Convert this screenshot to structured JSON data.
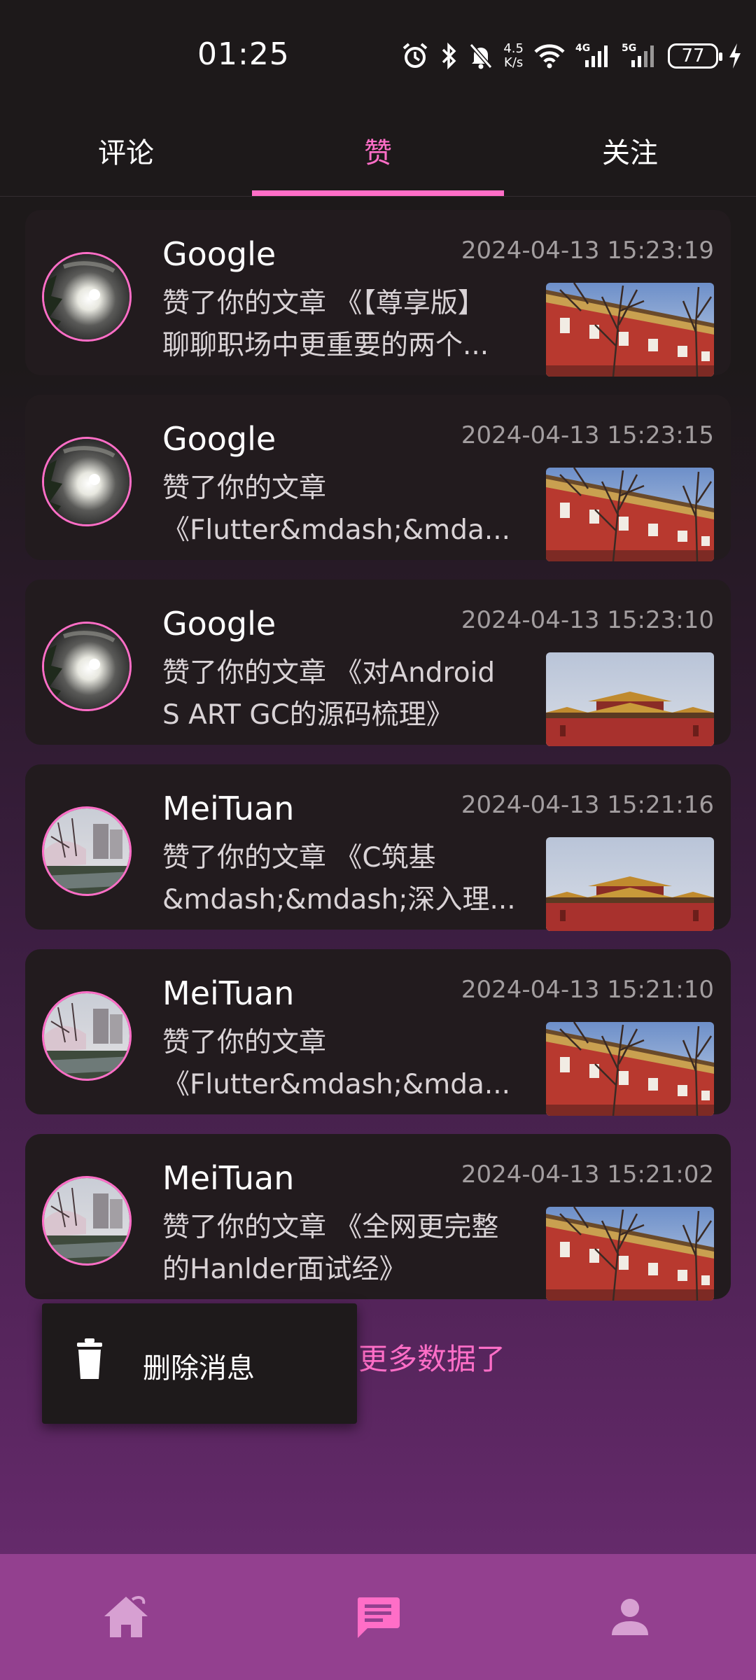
{
  "status_bar": {
    "time": "01:25",
    "net_speed_value": "4.5",
    "net_speed_unit": "K/s",
    "battery": "77",
    "icons": [
      "alarm-icon",
      "bluetooth-icon",
      "mute-icon",
      "wifi-icon",
      "4g-signal-icon",
      "5g-signal-icon",
      "battery-icon",
      "charging-icon"
    ]
  },
  "tabs": [
    {
      "label": "评论",
      "active": false
    },
    {
      "label": "赞",
      "active": true
    },
    {
      "label": "关注",
      "active": false
    }
  ],
  "likes": [
    {
      "name": "Google",
      "time": "2024-04-13 15:23:19",
      "line1": "赞了你的文章 《【尊享版】",
      "line2": "聊聊职场中更重要的两个...",
      "thumb": "red-wall"
    },
    {
      "name": "Google",
      "time": "2024-04-13 15:23:15",
      "line1": "赞了你的文章",
      "line2": "《Flutter&mdash;&mda...",
      "thumb": "red-wall"
    },
    {
      "name": "Google",
      "time": "2024-04-13 15:23:10",
      "line1": "赞了你的文章 《对Android",
      "line2": "S ART GC的源码梳理》",
      "thumb": "palace"
    },
    {
      "name": "MeiTuan",
      "time": "2024-04-13 15:21:16",
      "line1": "赞了你的文章 《C筑基",
      "line2": "&mdash;&mdash;深入理...",
      "thumb": "palace"
    },
    {
      "name": "MeiTuan",
      "time": "2024-04-13 15:21:10",
      "line1": "赞了你的文章",
      "line2": "《Flutter&mdash;&mda...",
      "thumb": "red-wall"
    },
    {
      "name": "MeiTuan",
      "time": "2024-04-13 15:21:02",
      "line1": "赞了你的文章 《全网更完整",
      "line2": "的Hanlder面试经》",
      "thumb": "red-wall"
    }
  ],
  "popup_menu": {
    "delete_label": "删除消息"
  },
  "footer_text": "更多数据了",
  "bottom_nav": [
    {
      "icon": "home-icon",
      "active": false
    },
    {
      "icon": "message-icon",
      "active": true
    },
    {
      "icon": "person-icon",
      "active": false
    }
  ],
  "colors": {
    "accent": "#ff6ec7",
    "nav_bg": "#93408f",
    "card_bg": "#221b1e"
  }
}
